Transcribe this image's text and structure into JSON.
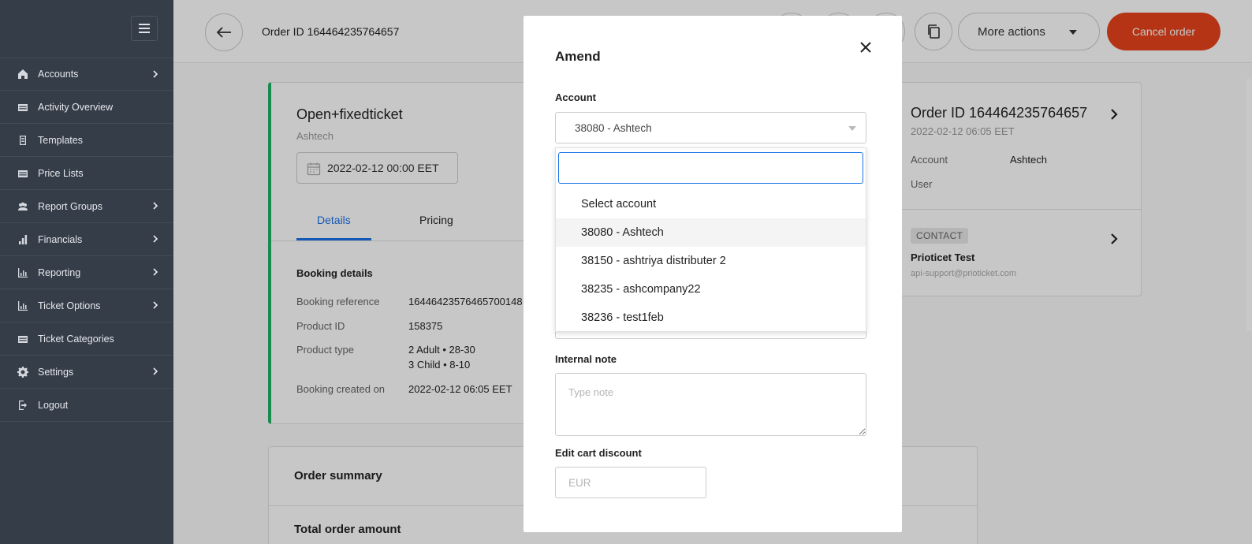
{
  "sidebar": {
    "items": [
      {
        "label": "Accounts",
        "icon": "home-icon",
        "chevron": true
      },
      {
        "label": "Activity Overview",
        "icon": "table-icon",
        "chevron": false
      },
      {
        "label": "Templates",
        "icon": "document-icon",
        "chevron": false
      },
      {
        "label": "Price Lists",
        "icon": "table-icon",
        "chevron": false
      },
      {
        "label": "Report Groups",
        "icon": "users-icon",
        "chevron": true
      },
      {
        "label": "Financials",
        "icon": "bar-chart-icon",
        "chevron": true
      },
      {
        "label": "Reporting",
        "icon": "chart-icon",
        "chevron": true
      },
      {
        "label": "Ticket Options",
        "icon": "chart-icon",
        "chevron": true
      },
      {
        "label": "Ticket Categories",
        "icon": "table-icon",
        "chevron": false
      },
      {
        "label": "Settings",
        "icon": "gear-icon",
        "chevron": true
      },
      {
        "label": "Logout",
        "icon": "logout-icon",
        "chevron": false
      }
    ]
  },
  "topbar": {
    "order_id": "Order ID 164464235764657",
    "more_actions": "More actions",
    "cancel_order": "Cancel order"
  },
  "booking": {
    "product_title": "Open+fixedticket",
    "account_name": "Ashtech",
    "date": "2022-02-12 00:00 EET",
    "tab_details": "Details",
    "tab_pricing": "Pricing",
    "section_title": "Booking details",
    "rows": [
      {
        "label": "Booking reference",
        "value": "16446423576465700148"
      },
      {
        "label": "Product ID",
        "value": "158375"
      },
      {
        "label": "Product type",
        "value": "2 Adult • 28-30"
      },
      {
        "label": "Booking created on",
        "value": "2022-02-12 06:05 EET"
      }
    ],
    "product_type_line2": "3 Child • 8-10"
  },
  "summary": {
    "title": "Order summary",
    "total_title": "Total order amount"
  },
  "order_card": {
    "title": "Order ID 164464235764657",
    "date": "2022-02-12 06:05 EET",
    "account_label": "Account",
    "account_value": "Ashtech",
    "user_label": "User",
    "contact_badge": "CONTACT",
    "contact_name": "Prioticet Test",
    "contact_email": "api-support@prioticket.com"
  },
  "modal": {
    "title": "Amend",
    "account_label": "Account",
    "selected_account": "38080 - Ashtech",
    "search_value": "",
    "options": [
      "Select account",
      "38080 - Ashtech",
      "38150 - ashtriya distributer 2",
      "38235 - ashcompany22",
      "38236 - test1feb"
    ],
    "highlighted_index": 1,
    "internal_note_label": "Internal note",
    "internal_note_placeholder": "Type note",
    "discount_label": "Edit cart discount",
    "discount_placeholder": "EUR"
  },
  "colors": {
    "sidebar_bg": "#353d49",
    "accent": "#1a73e8",
    "cancel": "#e8431c",
    "status_green": "#1fb265"
  }
}
